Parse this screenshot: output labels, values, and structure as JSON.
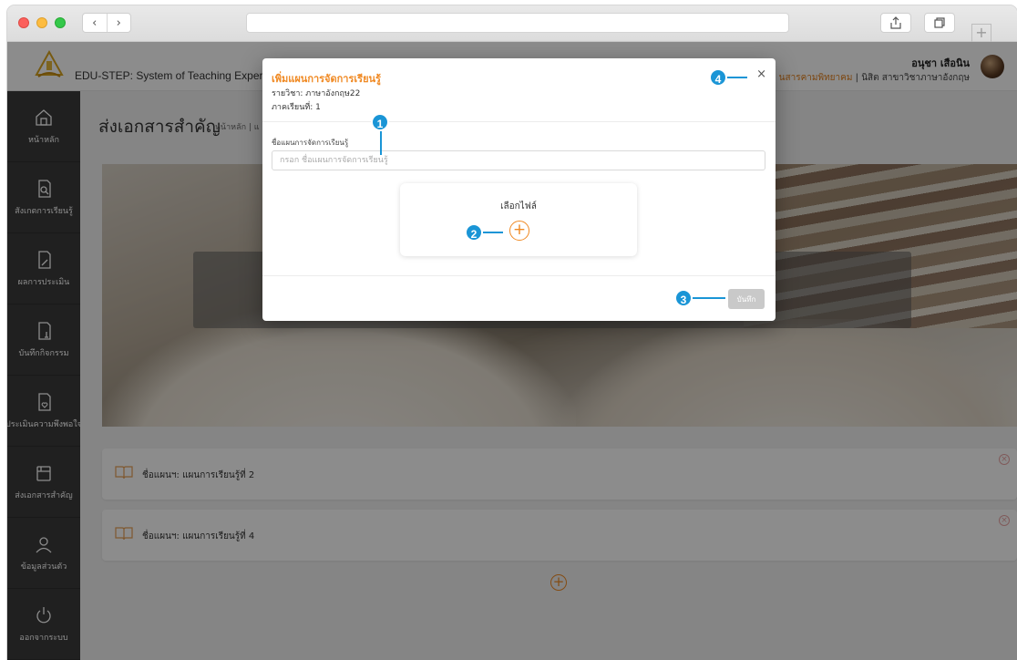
{
  "browser": {
    "back_glyph": "‹",
    "forward_glyph": "›",
    "new_tab_glyph": "+"
  },
  "header": {
    "app_title": "EDU-STEP: System of Teaching Experi",
    "user_name": "อนุชา เสือนิน",
    "user_university": "นสารคามพิทยาคม",
    "user_separator": "|",
    "user_department": "นิสิต สาขาวิชาภาษาอังกฤษ"
  },
  "sidebar": {
    "items": [
      {
        "label": "หน้าหลัก",
        "icon": "home-icon"
      },
      {
        "label": "สังเกตการเรียนรู้",
        "icon": "document-search-icon"
      },
      {
        "label": "ผลการประเมิน",
        "icon": "document-edit-icon"
      },
      {
        "label": "บันทึกกิจกรรม",
        "icon": "document-pen-icon"
      },
      {
        "label": "ประเมินความพึงพอใจ",
        "icon": "document-heart-icon"
      },
      {
        "label": "ส่งเอกสารสำคัญ",
        "icon": "folder-icon"
      },
      {
        "label": "ข้อมูลส่วนตัว",
        "icon": "user-icon"
      },
      {
        "label": "ออกจากระบบ",
        "icon": "power-icon"
      }
    ]
  },
  "main": {
    "page_title": "ส่งเอกสารสำคัญ",
    "breadcrumb": "หน้าหลัก | แ",
    "plans": [
      {
        "text": "ชื่อแผนฯ: แผนการเรียนรู้ที่ 2"
      },
      {
        "text": "ชื่อแผนฯ: แผนการเรียนรู้ที่ 4"
      }
    ],
    "remove_glyph": "×",
    "add_glyph": "+"
  },
  "modal": {
    "title": "เพิ่มแผนการจัดการเรียนรู้",
    "subject": "รายวิชา: ภาษาอังกฤษ22",
    "semester": "ภาคเรียนที่: 1",
    "close_glyph": "×",
    "field_label": "ชื่อแผนการจัดการเรียนรู้",
    "field_placeholder": "กรอก ชื่อแผนการจัดการเรียนรู้",
    "field_value": "",
    "file_label": "เลือกไฟล์",
    "file_add_glyph": "+",
    "save_label": "บันทึก"
  },
  "callouts": [
    "1",
    "2",
    "3",
    "4"
  ],
  "colors": {
    "accent": "#f08a24",
    "sidebar": "#3b3b3b",
    "callout": "#1a95d6",
    "save_disabled": "#c9c9c9"
  }
}
